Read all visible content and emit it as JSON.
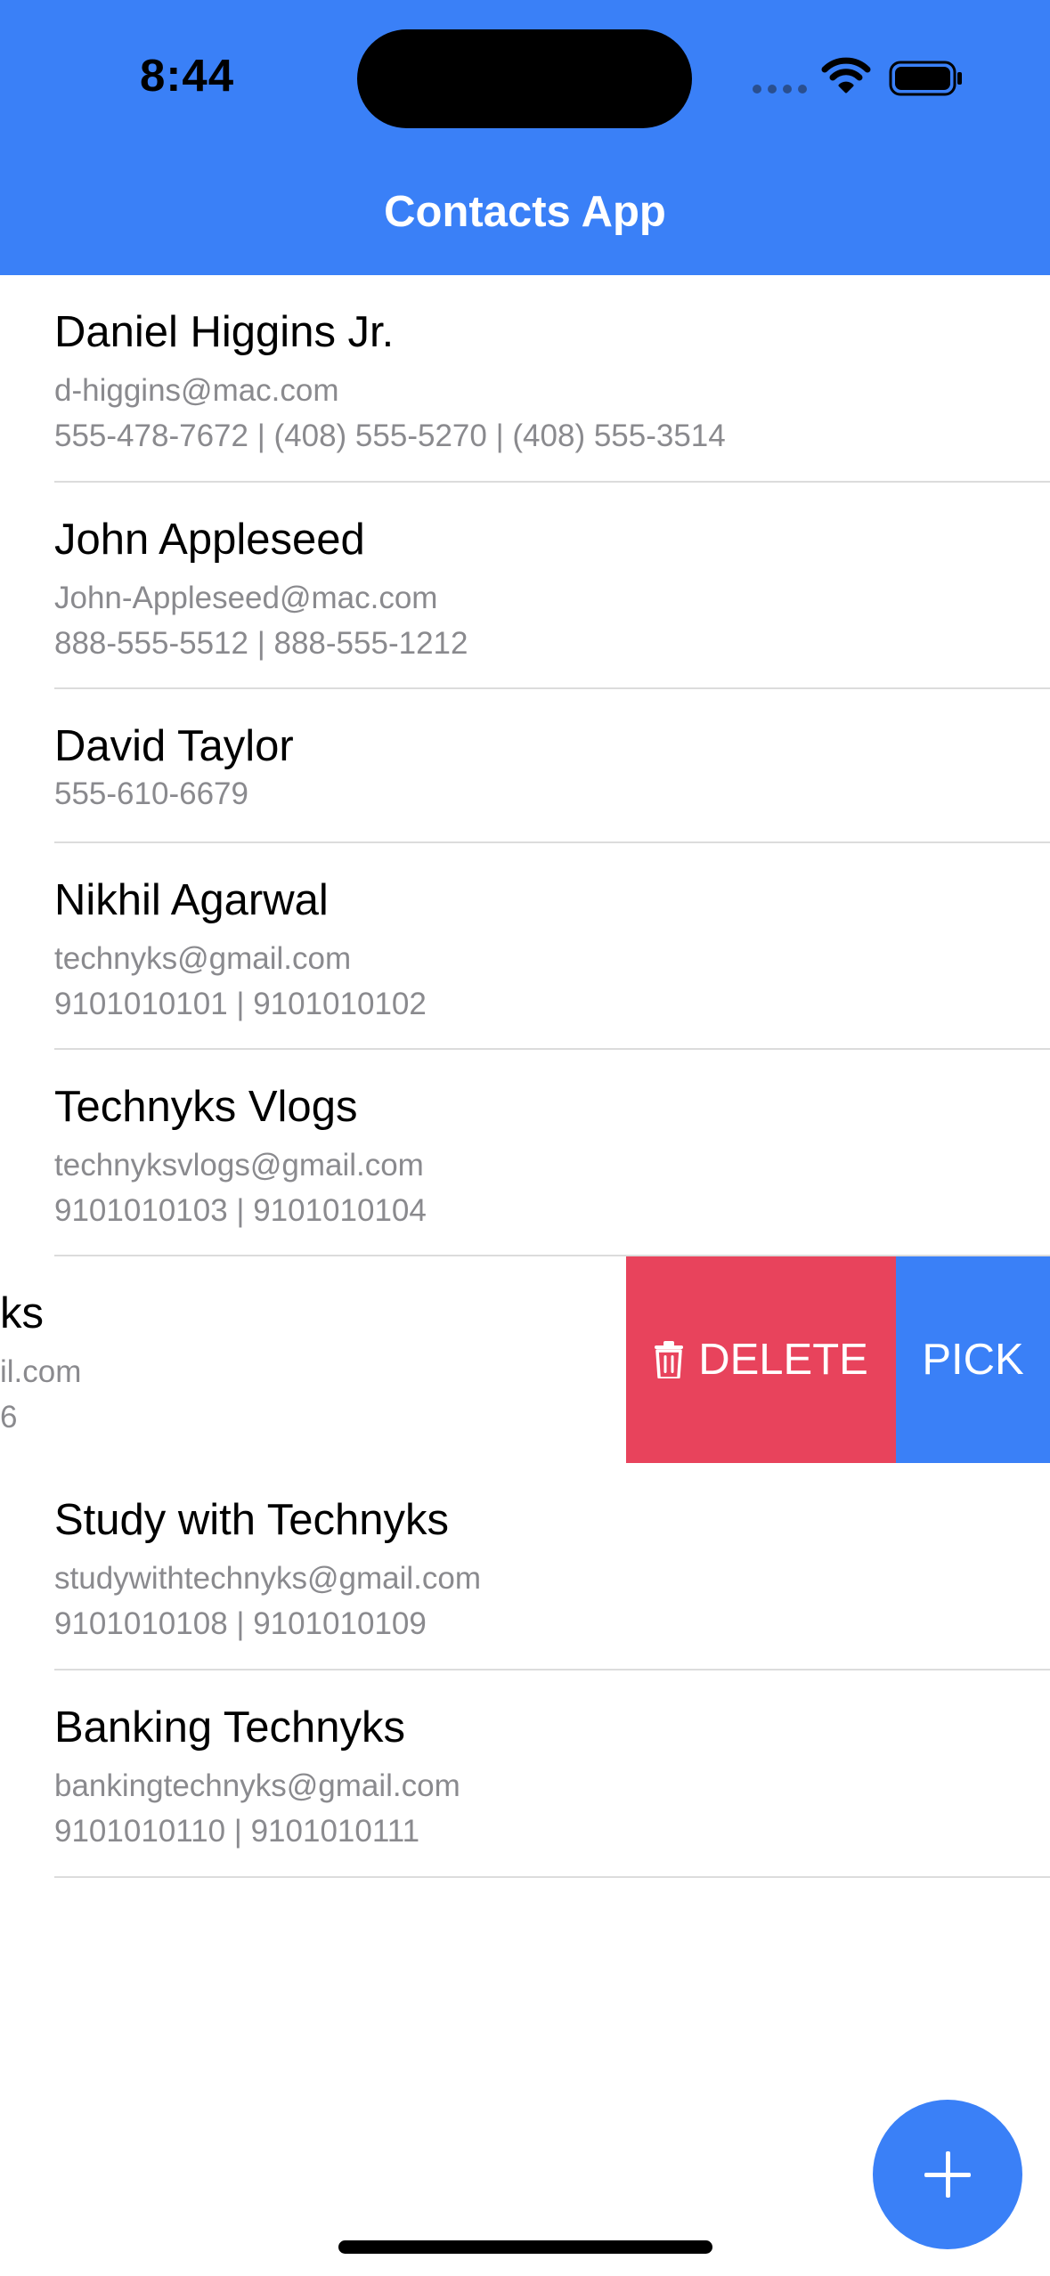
{
  "status_bar": {
    "time": "8:44"
  },
  "header": {
    "title": "Contacts App"
  },
  "contacts": [
    {
      "name": "Daniel Higgins Jr.",
      "email": "d-higgins@mac.com",
      "phones": "555-478-7672 | (408) 555-5270 | (408) 555-3514"
    },
    {
      "name": "John Appleseed",
      "email": "John-Appleseed@mac.com",
      "phones": "888-555-5512 | 888-555-1212"
    },
    {
      "name": "David Taylor",
      "phones": "555-610-6679"
    },
    {
      "name": "Nikhil Agarwal",
      "email": "technyks@gmail.com",
      "phones": "9101010101 | 9101010102"
    },
    {
      "name": "Technyks Vlogs",
      "email": "technyksvlogs@gmail.com",
      "phones": "9101010103 | 9101010104"
    },
    {
      "name_partial": "ks",
      "email_partial": "il.com",
      "phones_partial": "6"
    },
    {
      "name": "Study with Technyks",
      "email": "studywithtechnyks@gmail.com",
      "phones": "9101010108 | 9101010109"
    },
    {
      "name": "Banking Technyks",
      "email": "bankingtechnyks@gmail.com",
      "phones": "9101010110 | 9101010111"
    }
  ],
  "swipe_actions": {
    "delete_label": "DELETE",
    "pick_label": "PICK"
  },
  "icons": {
    "delete": "trash-icon",
    "fab": "plus-icon",
    "wifi": "wifi-icon",
    "battery": "battery-icon"
  },
  "colors": {
    "primary": "#3a80f7",
    "delete": "#e8435c",
    "secondary_text": "#8a8a8e"
  }
}
